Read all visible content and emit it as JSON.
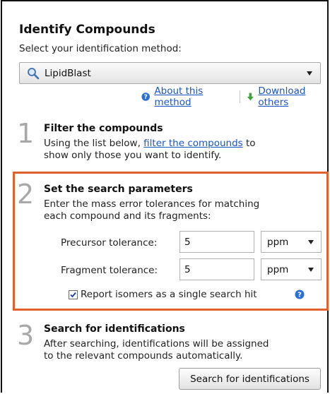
{
  "header": {
    "title": "Identify Compounds",
    "subtitle": "Select your identification method:"
  },
  "method_select": {
    "icon": "magnifier-icon",
    "value": "LipidBlast"
  },
  "links": {
    "about": "About this method",
    "download": "Download others"
  },
  "step1": {
    "number": "1",
    "title": "Filter the compounds",
    "desc_before": "Using the list below, ",
    "desc_link": "filter the compounds",
    "desc_after": " to",
    "desc_line2": "show only those you want to identify."
  },
  "step2": {
    "number": "2",
    "title": "Set the search parameters",
    "desc_line1": "Enter the mass error tolerances for matching",
    "desc_line2": "each compound and its fragments:",
    "precursor": {
      "label": "Precursor tolerance:",
      "value": "5",
      "unit": "ppm"
    },
    "fragment": {
      "label": "Fragment tolerance:",
      "value": "5",
      "unit": "ppm"
    },
    "isomers": {
      "label": "Report isomers as a single search hit",
      "checked": true
    }
  },
  "step3": {
    "number": "3",
    "title": "Search for identifications",
    "desc_line1": "After searching, identifications will be assigned",
    "desc_line2": "to the relevant compounds automatically.",
    "button": "Search for identifications"
  },
  "colors": {
    "highlight_border": "#e0612b",
    "link": "#1a55c4",
    "step_number": "#a8a8a8"
  }
}
